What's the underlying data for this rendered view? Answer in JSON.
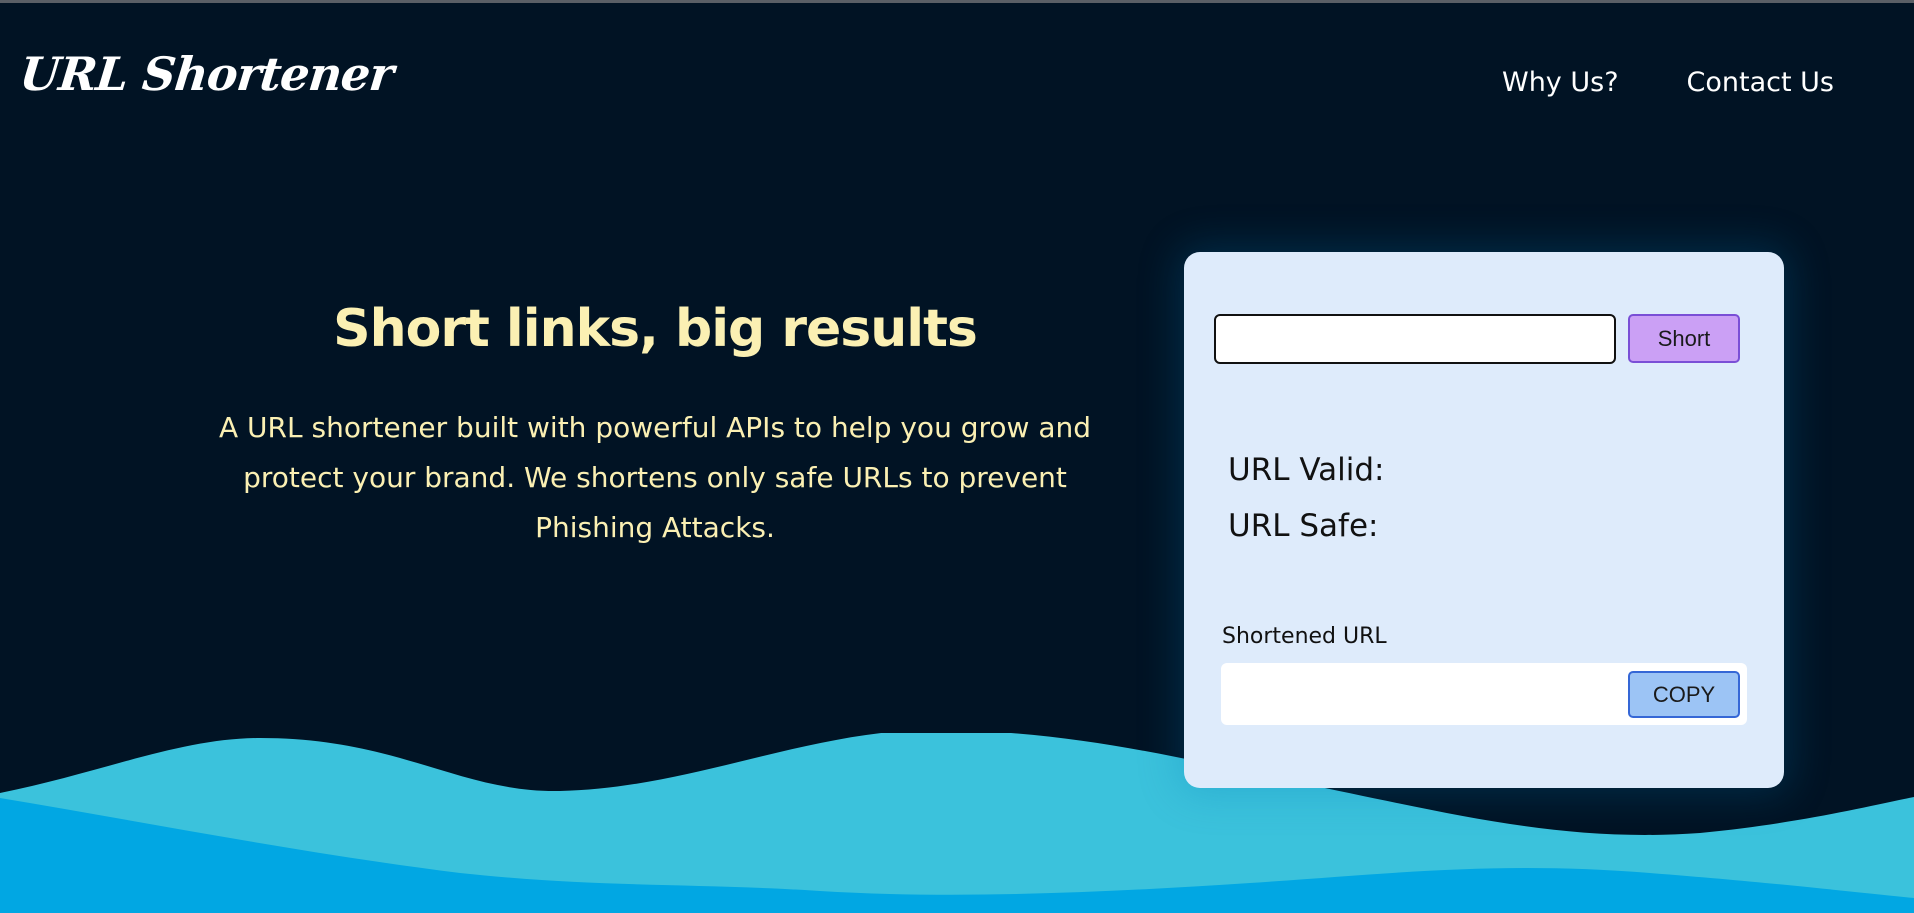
{
  "header": {
    "logo_text": "URL Shortener",
    "nav": [
      {
        "label": "Why Us?"
      },
      {
        "label": "Contact Us"
      }
    ]
  },
  "hero": {
    "title": "Short links, big results",
    "description": "A URL shortener built with powerful APIs to help you grow and protect your brand. We shortens only safe URLs to prevent Phishing Attacks."
  },
  "card": {
    "url_input": {
      "value": "",
      "placeholder": ""
    },
    "short_button_label": "Short",
    "url_valid_label": "URL Valid:",
    "url_safe_label": "URL Safe:",
    "shortened_label": "Shortened URL",
    "shortened_value": "",
    "copy_button_label": "COPY"
  },
  "colors": {
    "background": "#011324",
    "hero_text": "#fbf0b3",
    "card_background": "#deebfb",
    "short_button": "#cba0f5",
    "copy_button": "#9cc4f5",
    "wave_light": "#3bc2dc",
    "wave_dark": "#01a7e3"
  }
}
